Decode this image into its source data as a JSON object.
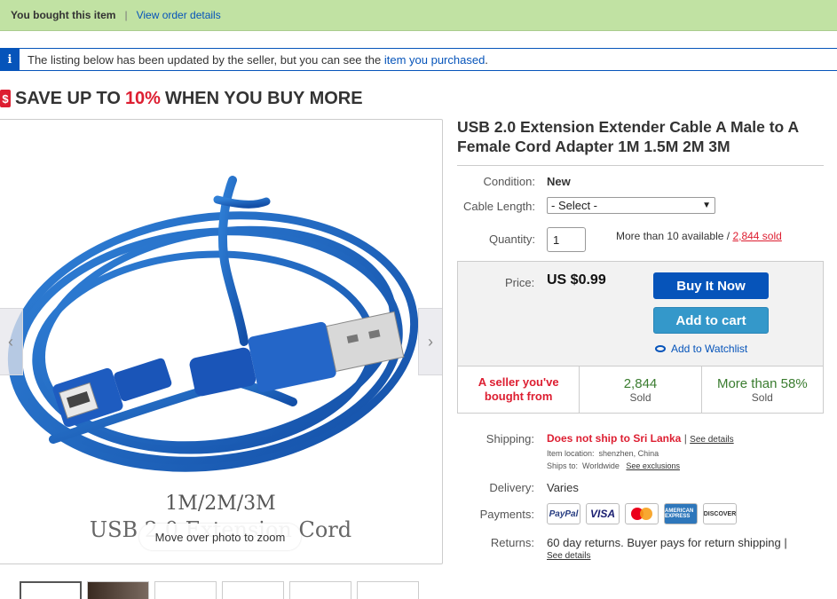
{
  "bought_bar": {
    "text": "You bought this item",
    "separator": "|",
    "link": "View order details"
  },
  "info_bar": {
    "icon": "i",
    "text": "The listing below has been updated by the seller, but you can see the",
    "link": "item you purchased",
    "end": "."
  },
  "promo": {
    "tag_icon": "$",
    "prefix": "SAVE UP TO",
    "percent": "10%",
    "suffix": "WHEN YOU BUY MORE"
  },
  "gallery": {
    "caption_line1": "1M/2M/3M",
    "caption_line2": "USB 2.0 Extension Cord",
    "zoom_hint": "Move over photo to zoom",
    "prev_icon": "‹",
    "next_icon": "›"
  },
  "product": {
    "title": "USB 2.0 Extension Extender Cable A Male to A Female Cord Adapter 1M 1.5M 2M 3M",
    "condition_label": "Condition:",
    "condition_value": "New",
    "cable_length_label": "Cable Length:",
    "cable_length_selected": "- Select -",
    "quantity_label": "Quantity:",
    "quantity_value": "1",
    "available": "More than 10 available /",
    "sold_link": "2,844 sold"
  },
  "purchase": {
    "price_label": "Price:",
    "price": "US $0.99",
    "buy_now": "Buy It Now",
    "add_to_cart": "Add to cart",
    "watchlist": "Add to Watchlist",
    "stats": {
      "seller_line1": "A seller you've",
      "seller_line2": "bought from",
      "sold_count": "2,844",
      "sold_label": "Sold",
      "pct": "More than 58%",
      "pct_label": "Sold"
    }
  },
  "shipping": {
    "label": "Shipping:",
    "status": "Does not ship to Sri Lanka",
    "sep": "|",
    "details_link": "See details",
    "location_label": "Item location:",
    "location": "shenzhen, China",
    "ships_to_label": "Ships to:",
    "ships_to": "Worldwide",
    "exclusions_link": "See exclusions"
  },
  "delivery": {
    "label": "Delivery:",
    "value": "Varies"
  },
  "payments": {
    "label": "Payments:",
    "methods": [
      "PayPal",
      "VISA",
      "Mastercard",
      "AMERICAN EXPRESS",
      "DISCOVER"
    ]
  },
  "returns": {
    "label": "Returns:",
    "value": "60 day returns. Buyer pays for return shipping |",
    "link": "See details"
  },
  "colors": {
    "ebay_blue": "#0654ba",
    "ebay_red": "#dd1e31",
    "green_bar": "#c1e2a3",
    "cart_blue": "#3498ca",
    "stat_green": "#3a7c2f"
  }
}
